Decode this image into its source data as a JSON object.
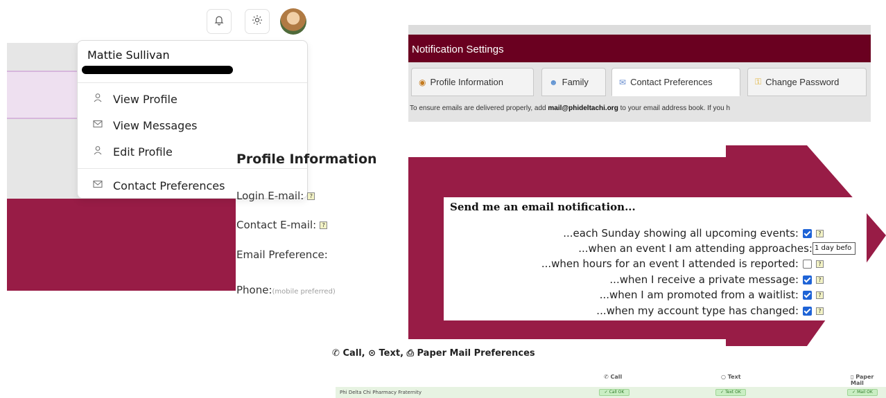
{
  "header": {
    "icons": [
      "bell-icon",
      "sun-icon"
    ],
    "avatar": "user-avatar"
  },
  "user_menu": {
    "name": "Mattie Sullivan",
    "items": [
      {
        "label": "View Profile",
        "icon": "person-icon"
      },
      {
        "label": "View Messages",
        "icon": "envelope-icon"
      },
      {
        "label": "Edit Profile",
        "icon": "person-icon"
      },
      {
        "label": "Contact Preferences",
        "icon": "envelope-icon"
      }
    ]
  },
  "profile_info": {
    "title": "Profile Information",
    "login_email_label": "Login E-mail:",
    "contact_email_label": "Contact E-mail:",
    "email_pref_label": "Email Preference:",
    "phone_label": "Phone:",
    "phone_hint": "(mobile preferred)"
  },
  "notification_settings": {
    "title": "Notification Settings",
    "tabs": [
      {
        "label": "Profile Information",
        "icon": "profile-icon",
        "active": false
      },
      {
        "label": "Family",
        "icon": "family-icon",
        "active": false
      },
      {
        "label": "Contact Preferences",
        "icon": "envelope-icon",
        "active": true
      },
      {
        "label": "Change Password",
        "icon": "key-icon",
        "active": false
      }
    ],
    "info_prefix": "To ensure emails are delivered properly, add ",
    "info_email": "mail@phideltachi.org",
    "info_suffix": " to your email address book. If you h"
  },
  "email_notifications": {
    "title": "Send me an email notification...",
    "rows": [
      {
        "label": "...each Sunday showing all upcoming events:",
        "checked": true
      },
      {
        "label": "...when an event I am attending approaches:",
        "select": "1 day befo"
      },
      {
        "label": "...when hours for an event I attended is reported:",
        "checked": false
      },
      {
        "label": "...when I receive a private message:",
        "checked": true
      },
      {
        "label": "...when I am promoted from a waitlist:",
        "checked": true
      },
      {
        "label": "...when my account type has changed:",
        "checked": true
      }
    ]
  },
  "contact_prefs": {
    "title": "Call, ⊙ Text, ⎙ Paper Mail Preferences",
    "columns": [
      "Call",
      "Text",
      "Paper Mail"
    ],
    "rows": [
      {
        "org": "Phi Delta Chi Pharmacy Fraternity",
        "call": "✓ Call OK",
        "text": "✓ Text OK",
        "mail": "✓ Mail OK"
      }
    ]
  },
  "colors": {
    "maroon": "#981c46",
    "header_dark": "#6a0020",
    "checkbox_blue": "#1e63d6"
  }
}
